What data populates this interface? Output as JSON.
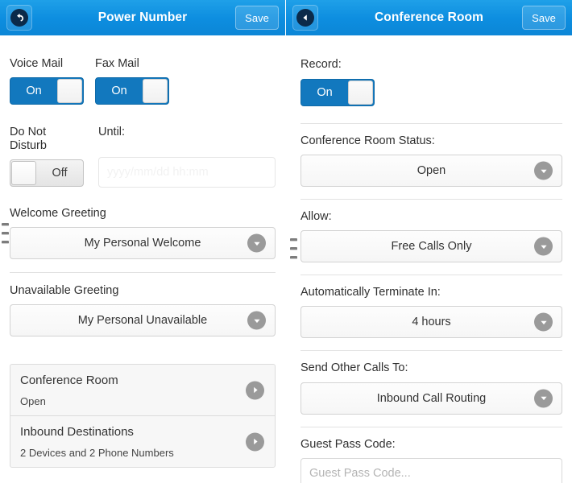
{
  "left_panel": {
    "header": {
      "back_icon": "back-undo-arrow-icon",
      "title": "Power Number",
      "save_label": "Save"
    },
    "voice_mail": {
      "label": "Voice Mail",
      "state": "On"
    },
    "fax_mail": {
      "label": "Fax Mail",
      "state": "On"
    },
    "do_not_disturb": {
      "label": "Do Not Disturb",
      "state": "Off"
    },
    "until": {
      "label": "Until:",
      "value": "",
      "placeholder": "yyyy/mm/dd hh:mm"
    },
    "welcome_greeting": {
      "label": "Welcome Greeting",
      "value": "My Personal Welcome"
    },
    "unavailable_greeting": {
      "label": "Unavailable Greeting",
      "value": "My Personal Unavailable"
    },
    "list": [
      {
        "title": "Conference Room",
        "subtitle": "Open"
      },
      {
        "title": "Inbound Destinations",
        "subtitle": "2 Devices and 2 Phone Numbers"
      }
    ]
  },
  "right_panel": {
    "header": {
      "back_icon": "chevron-left-circle-icon",
      "title": "Conference Room",
      "save_label": "Save"
    },
    "record": {
      "label": "Record:",
      "state": "On"
    },
    "status": {
      "label": "Conference Room Status:",
      "value": "Open"
    },
    "allow": {
      "label": "Allow:",
      "value": "Free Calls Only"
    },
    "terminate": {
      "label": "Automatically Terminate In:",
      "value": "4 hours"
    },
    "send_other_calls": {
      "label": "Send Other Calls To:",
      "value": "Inbound Call Routing"
    },
    "guest_pass_code": {
      "label": "Guest Pass Code:",
      "value": "",
      "placeholder": "Guest Pass Code..."
    }
  },
  "colors": {
    "header_blue": "#0d8ee0",
    "toggle_on_blue": "#1278be",
    "icon_gray": "#9a9a9a"
  }
}
